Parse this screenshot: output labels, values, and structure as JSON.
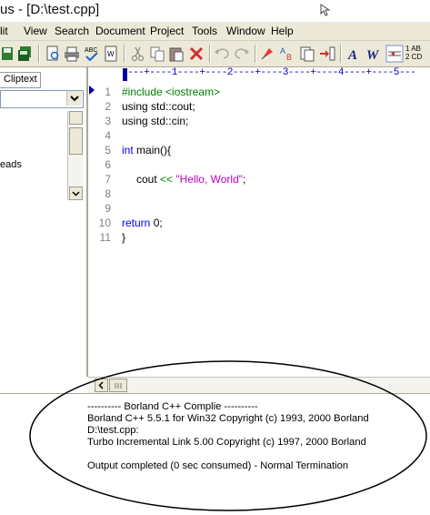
{
  "window": {
    "title": "us - [D:\\test.cpp]"
  },
  "menu": [
    "lit",
    "View",
    "Search",
    "Document",
    "Project",
    "Tools",
    "Window",
    "Help"
  ],
  "toolbar": {
    "icons": [
      "save-icon",
      "save-all-icon",
      "print-preview-icon",
      "print-icon",
      "spell-check-icon",
      "word-count-icon",
      "cut-icon",
      "copy-icon",
      "paste-icon",
      "delete-icon",
      "undo-icon",
      "redo-icon",
      "find-icon",
      "replace-icon",
      "file-compare-icon",
      "insert-icon",
      "font-icon",
      "word-wrap-icon",
      "indent-icon",
      "sort-icon"
    ],
    "sort_label_1": "1 AB",
    "sort_label_2": "2 CD"
  },
  "left_pane": {
    "tab": "Cliptext",
    "list_item": "eads"
  },
  "ruler": {
    "text": "---+----1----+----2----+----3----+----4----+----5---"
  },
  "editor": {
    "lines": [
      {
        "num": "1",
        "text": "#include <iostream>"
      },
      {
        "num": "2",
        "text": "using std::cout;"
      },
      {
        "num": "3",
        "text": "using std::cin;"
      },
      {
        "num": "4",
        "text": ""
      },
      {
        "num": "5",
        "text": "int main(){"
      },
      {
        "num": "6",
        "text": ""
      },
      {
        "num": "7",
        "text": "    cout << \"Hello, World\";"
      },
      {
        "num": "8",
        "text": ""
      },
      {
        "num": "9",
        "text": ""
      },
      {
        "num": "10",
        "text": "return 0;"
      },
      {
        "num": "11",
        "text": "}"
      }
    ],
    "tokens": {
      "include": "#include ",
      "iostream": "<iostream>",
      "using1": "using std::cout;",
      "using2": "using std::cin;",
      "int": "int",
      "main": " main(){",
      "cout": "cout ",
      "op": "<<",
      "str": "\"Hello, World\"",
      "semi": ";",
      "return": "return",
      "zero": " 0;",
      "close": "}"
    }
  },
  "output": {
    "lines": [
      "---------- Borland C++ Complie ----------",
      "Borland C++ 5.5.1 for Win32 Copyright (c) 1993, 2000 Borland",
      "D:\\test.cpp:",
      "Turbo Incremental Link 5.00 Copyright (c) 1997, 2000 Borland",
      "",
      "Output completed (0 sec consumed) - Normal Termination"
    ]
  },
  "colors": {
    "keyword": "#0000ff",
    "preprocessor": "#008000",
    "string": "#c000c0",
    "line_number": "#808080",
    "annotation": "#000000"
  }
}
